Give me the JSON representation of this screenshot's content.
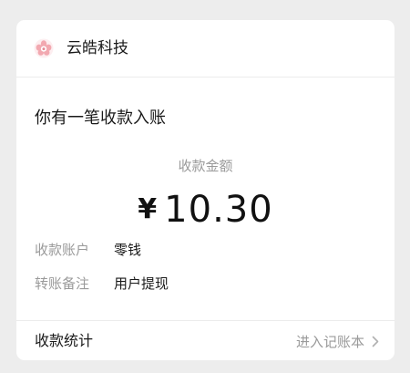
{
  "notification": {
    "sender": "云皓科技",
    "headline": "你有一笔收款入账",
    "amount_label": "收款金额",
    "currency": "¥",
    "amount": "10.30",
    "details": [
      {
        "key": "收款账户",
        "value": "零钱"
      },
      {
        "key": "转账备注",
        "value": "用户提现"
      }
    ],
    "footer_title": "收款统计",
    "footer_link": "进入记账本"
  },
  "icons": {
    "logo": "pink-flower-logo-icon",
    "chevron": "chevron-right-icon"
  },
  "colors": {
    "background": "#ededed",
    "card": "#ffffff",
    "primary_text": "#1a1a1a",
    "secondary_text": "#9a9a9a",
    "logo_pink": "#f2a8b0"
  }
}
